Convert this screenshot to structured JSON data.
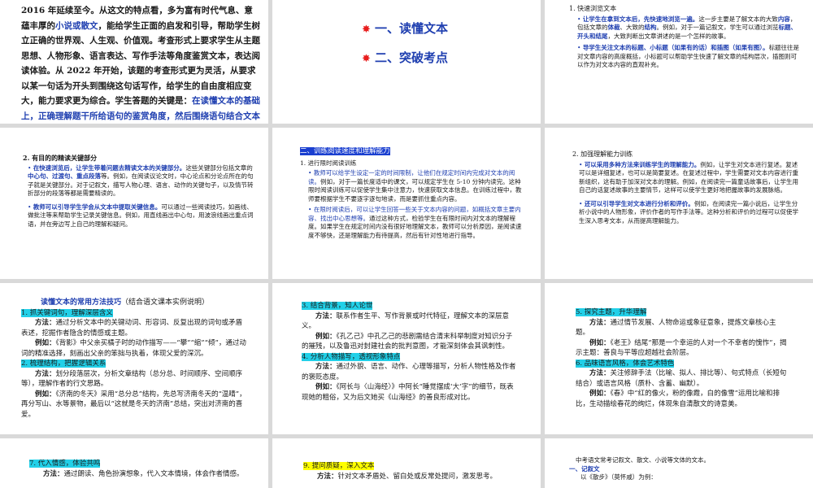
{
  "s1": {
    "p1": "2016 年延续至今。从这文的特点看，多为富有时代气息、意蕴丰厚的",
    "p1_blue": "小说或散文",
    "p1b": "，能给学生正面的启发和引导，帮助学生树立正确的世界观、人生观、价值观。考查形式上要求学生从主题思想、人物形象、语言表达、写作手法等角度鉴赏文本，表达阅读体验。从 2022 年开始，该题的考查形式更为灵活，从要求以某一句话为开头到围绕这句话写作，给学生的自由度相应变大，能力要求更为综合。学生答题的关键是：",
    "p1_key": "在读懂文本的基础上，正确理解题干所给语句的鉴赏角度，然后围绕语句结合文本进行深入赏析。"
  },
  "s2": {
    "item1": "一、读懂文本",
    "item2": "二、突破考点"
  },
  "s3": {
    "title": "1.   快速浏览文本",
    "b1_blue": "让学生在拿到文本后，先快速地浏览一遍。",
    "b1": "这一步主要是了解文本的大致",
    "b1_k1": "内容",
    "b1_m": "，包括文章的",
    "b1_k2": "体裁",
    "b1_m2": "、大致的",
    "b1_k3": "结构",
    "b1_e": "。例如，对于一篇记叙文，学生可以通过浏览",
    "b1_k4": "标题、开头和结尾",
    "b1_e2": "，大致判断出文章讲述的是一个怎样的故事。",
    "b2_blue": "导学生关注文本的标题、小标题（如果有的话）和插图（如果有图）。",
    "b2": "标题往往是对文章内容的高度概括，小标题可以帮助学生快速了解文章的结构层次，插图则可以作为对文本内容的直观补充。"
  },
  "s4": {
    "title": "2. 有目的的精读关键部分",
    "b1_blue": "在快速浏览后，让学生带着问题去精读文本的关键部分。",
    "b1": "这些关键部分包括文章的",
    "b1_k": "中心句、过渡句、重点段落",
    "b1_e": "等。例如，在阅读议论文时，中心论点和分论点所在的句子就是关键部分。对于记叙文，描写人物心理、语言、动作的关键句子，以及情节转折部分的段落等都是需要精读的。",
    "b2_blue": "教师可以引导学生学会从文本中提取关键信息。",
    "b2": "可以通过一些阅读技巧，如画线、做批注等来帮助学生记录关键信息。例如，用直线画出中心句，用波浪线画出重点词语，并在旁边写上自己的理解和疑问。"
  },
  "s5": {
    "title": "二、训练阅读速度和理解能力",
    "sub": "1.   进行限时阅读训练",
    "b1_blue": "教师可以给学生设定一定的时间限制，让他们在规定时间内完成对文本的阅读。",
    "b1": "例如，对于一篇长度适中的课文，可以规定学生在 5-10 分钟内读完。这种限时阅读训练可以促使学生集中注意力，快速获取文本信息。在训练过程中，教师要根据学生不要逐字逐句地读，而是要抓住重点内容。",
    "b2_blue": "在限时阅读后，可以让学生回答一些关于文本内容的问题，如概括文章主要内容、找出中心思想等。",
    "b2": "通过这种方式，检验学生在有限时间内对文本的理解程度。如果学生在规定时间内没有很好地理解文本，教师可以分析原因，是阅读速度不够快，还是理解能力有待提高，然后有针对性地进行指导。"
  },
  "s6": {
    "title": "2.   加强理解能力训练",
    "b1_blue": "可以采用多种方法来训练学生的理解能力。",
    "b1": "例如，让学生对文本进行复述。复述可以是详细复述，也可以是简要复述。在复述过程中，学生需要对文本内容进行重新组织，这有助于加深对文本的理解。例如，在阅读完一篇童话故事后，让学生用自己的话复述故事的主要情节，这样可以使学生更好地把握故事的发展脉络。",
    "b2_blue": "还可以引导学生对文本进行分析和评价。",
    "b2": "例如，在阅读完一篇小说后，让学生分析小说中的人物形象，评价作者的写作手法等。这种分析和评价的过程可以促使学生深入思考文本，从而提高理解能力。"
  },
  "s7": {
    "title": "读懂文本的常用方法技巧",
    "title_note": "（结合语文课本实例说明）",
    "h1": "1. 抓关键词句，理解深层含义",
    "m1_k": "方法：",
    "m1": "通过分析文本中的关键动词、形容词、反复出现的词句或矛盾表述，挖掘作者隐含的情感或主题。",
    "e1_k": "例如：",
    "e1": "《背影》中父亲买橘子时的动作描写——“攀”“缩”“倾”，通过动词的精准选择，刻画出父亲的笨拙与执着，体现父爱的深沉。",
    "h2": "2. 梳理结构，把握逻辑关系",
    "m2_k": "方法：",
    "m2": "划分段落层次，分析文章结构（总分总、时间顺序、空间顺序等），理解作者的行文思路。",
    "e2_k": "例如：",
    "e2": "《济南的冬天》采用“总分总”结构，先总写济南冬天的“温晴”，再分写山、水等景物，最后以“这就是冬天的济南”总结，突出对济南的喜爱。"
  },
  "s8": {
    "h3": "3. 结合背景，知人论世",
    "m3_k": "方法：",
    "m3": "联系作者生平、写作背景或时代特征，理解文本的深层意义。",
    "e3_k": "例如：",
    "e3": "《孔乙己》中孔乙己的悲剧需结合清末科举制度对知识分子的摧残，以及鲁迅对封建社会的批判意图，才能深刻体会其讽刺性。",
    "h4": "4. 分析人物描写，透视形象特点",
    "m4_k": "方法：",
    "m4": "通过外貌、语言、动作、心理等描写，分析人物性格及作者的褒贬态度。",
    "e4_k": "例如：",
    "e4": "《阿长与〈山海经〉》中阿长“睡觉摆成‘大’字”的细节，既表现她的粗俗，又为后文她买《山海经》的善良形成对比。"
  },
  "s9": {
    "h5": "5. 探究主题，升华理解",
    "m5_k": "方法：",
    "m5": "通过情节发展、人物命运或象征意象，提炼文章核心主题。",
    "e5_k": "例如：",
    "e5": "《老王》结尾“那是一个幸运的人对一个不幸者的愧怍”，揭示主题：善良与平等应超越社会阶层。",
    "h6": "6. 品味语言风格，体会艺术特色",
    "m6_k": "方法：",
    "m6": "关注修辞手法（比喻、拟人、排比等）、句式特点（长短句结合）或语言风格（质朴、含蓄、幽默）。",
    "e6_k": "例如：",
    "e6": "《春》中“红的像火，粉的像霞，白的像雪”运用比喻和排比，生动描绘春花的绚烂，体现朱自清散文的诗意美。"
  },
  "s10": {
    "h7": "7. 代入情感，体验共鸣",
    "m7_k": "方法：",
    "m7": "通过朗读、角色扮演想象，代入文本情境，体会作者情感。"
  },
  "s11": {
    "h9": "9. 提问质疑，深入文本",
    "m9_k": "方法：",
    "m9": "针对文本矛盾处、留白处或反常处提问，激发思考。"
  },
  "s12": {
    "intro": "中考语文常考记叙文、散文、小说等文体的文本。",
    "h1": "一、记叙文",
    "ex": "以《散步》（莫怀戚）为例："
  }
}
